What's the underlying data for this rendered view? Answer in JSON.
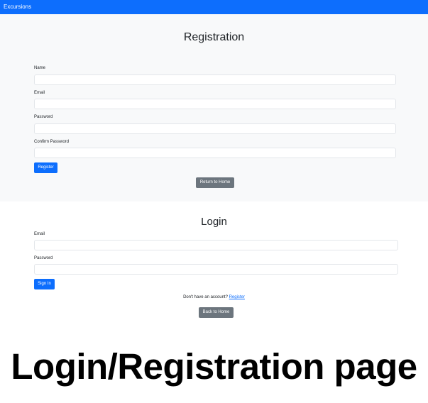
{
  "navbar": {
    "brand": "Excursions"
  },
  "registration": {
    "title": "Registration",
    "name_label": "Name",
    "email_label": "Email",
    "password_label": "Password",
    "confirm_password_label": "Confirm Password",
    "submit_label": "Register",
    "return_label": "Return to Home"
  },
  "login": {
    "title": "Login",
    "email_label": "Email",
    "password_label": "Password",
    "submit_label": "Sign In",
    "no_account_text": "Don't have an account?",
    "register_link": "Register",
    "back_label": "Back to Home"
  },
  "caption": "Login/Registration page",
  "colors": {
    "primary": "#0d6efd",
    "secondary": "#6c757d",
    "section_bg": "#f8f9fa"
  }
}
